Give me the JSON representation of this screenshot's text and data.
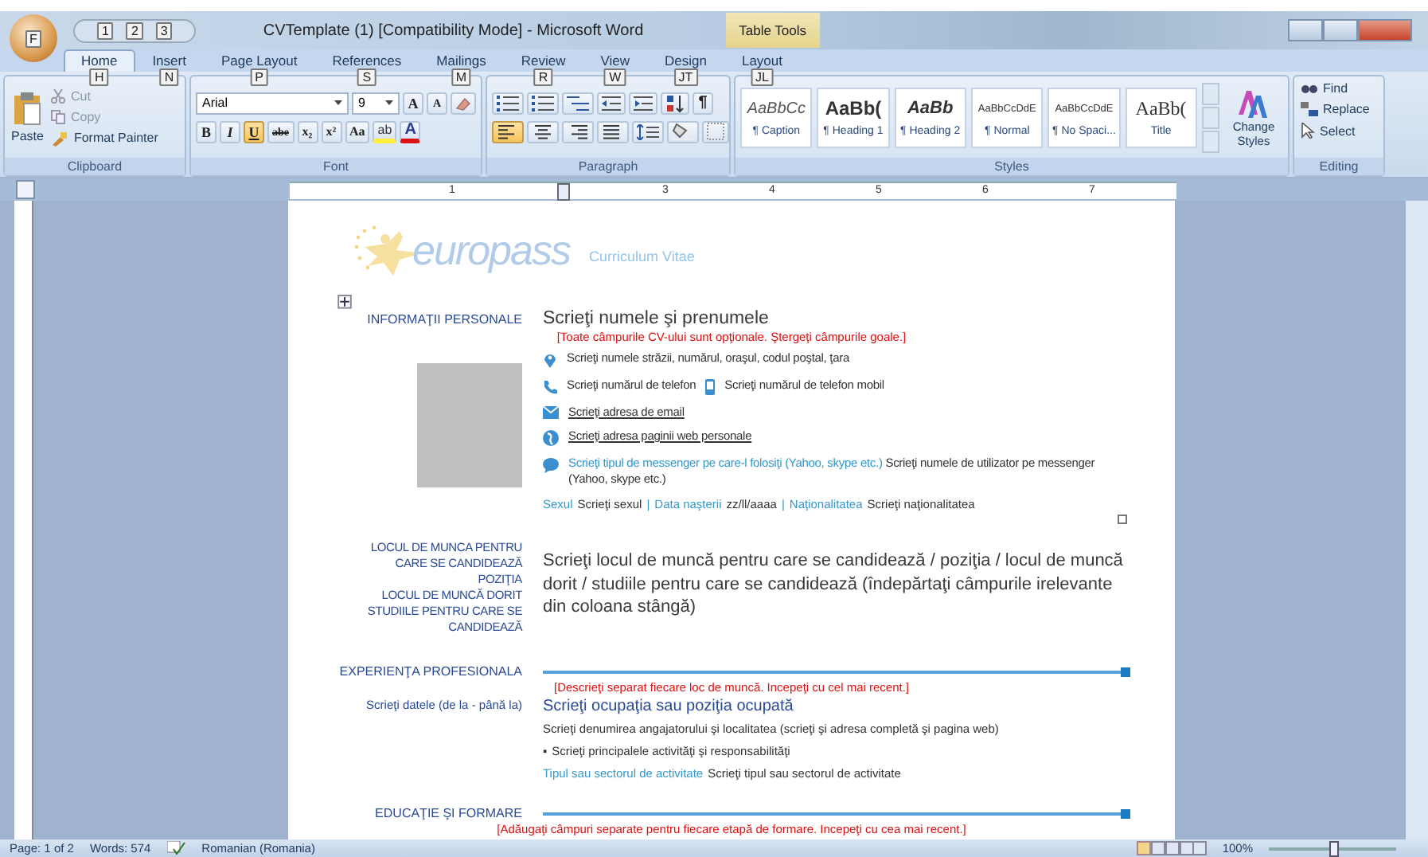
{
  "window": {
    "title": "CVTemplate (1) [Compatibility Mode] - Microsoft Word",
    "context_tab": "Table Tools",
    "office_keytip": "F",
    "quick_access_keytips": [
      "1",
      "2",
      "3"
    ]
  },
  "tabs": [
    {
      "label": "Home",
      "keytip": "H",
      "selected": true
    },
    {
      "label": "Insert",
      "keytip": "N",
      "selected": false
    },
    {
      "label": "Page Layout",
      "keytip": "P",
      "selected": false
    },
    {
      "label": "References",
      "keytip": "S",
      "selected": false
    },
    {
      "label": "Mailings",
      "keytip": "M",
      "selected": false
    },
    {
      "label": "Review",
      "keytip": "R",
      "selected": false
    },
    {
      "label": "View",
      "keytip": "W",
      "selected": false
    },
    {
      "label": "Design",
      "keytip": "JT",
      "selected": false
    },
    {
      "label": "Layout",
      "keytip": "JL",
      "selected": false
    }
  ],
  "clipboard": {
    "label": "Clipboard",
    "paste": "Paste",
    "cut": "Cut",
    "copy": "Copy",
    "format_painter": "Format Painter"
  },
  "font": {
    "label": "Font",
    "name": "Arial",
    "size": "9",
    "grow": "A",
    "shrink": "A",
    "styles": [
      {
        "label": "B",
        "kind": "bold",
        "on": false
      },
      {
        "label": "I",
        "kind": "italic",
        "on": false
      },
      {
        "label": "U",
        "kind": "underline",
        "on": true
      },
      {
        "label": "abe",
        "kind": "strike",
        "on": false
      },
      {
        "label": "x₂",
        "kind": "sub",
        "on": false
      },
      {
        "label": "x²",
        "kind": "sup",
        "on": false
      },
      {
        "label": "Aa",
        "kind": "case",
        "on": false
      }
    ],
    "highlight_label": "ab",
    "color_label": "A"
  },
  "paragraph": {
    "label": "Paragraph",
    "pilcrow": "¶",
    "alignments": [
      {
        "kind": "left",
        "selected": true
      },
      {
        "kind": "center",
        "selected": false
      },
      {
        "kind": "right",
        "selected": false
      },
      {
        "kind": "justify",
        "selected": false
      }
    ]
  },
  "styles": {
    "label": "Styles",
    "change_styles": "Change Styles",
    "items": [
      {
        "preview": "AaBbCc",
        "name": "¶ Caption",
        "kind": "caption"
      },
      {
        "preview": "AaBb(",
        "name": "¶ Heading 1",
        "kind": "heading1"
      },
      {
        "preview": "AaBb",
        "name": "¶ Heading 2",
        "kind": "heading2"
      },
      {
        "preview": "AaBbCcDdE",
        "name": "¶ Normal",
        "kind": "normal"
      },
      {
        "preview": "AaBbCcDdE",
        "name": "¶ No Spaci...",
        "kind": "normal"
      },
      {
        "preview": "AaBb(",
        "name": "Title",
        "kind": "title"
      }
    ]
  },
  "editing": {
    "label": "Editing",
    "find": "Find",
    "replace": "Replace",
    "select": "Select"
  },
  "ruler": {
    "numbers": [
      "1",
      "3",
      "4",
      "5",
      "6",
      "7"
    ]
  },
  "document": {
    "logo": "europass",
    "cv_title": "Curriculum Vitae",
    "personal": {
      "heading": "INFORMAŢII PERSONALE",
      "name": "Scrieţi numele şi prenumele",
      "note": "[Toate câmpurile CV-ului sunt opţionale. Ştergeţi câmpurile goale.]",
      "contacts": [
        {
          "kind": "address",
          "text": "Scrieţi numele străzii, numărul, oraşul, codul poştal, ţara"
        },
        {
          "kind": "phone",
          "text": "Scrieţi numărul de telefon",
          "mobile": "Scrieţi numărul de telefon mobil"
        },
        {
          "kind": "email",
          "text": "Scrieţi adresa de email"
        },
        {
          "kind": "web",
          "text": "Scrieţi adresa paginii web personale"
        },
        {
          "kind": "messenger",
          "label": "Scrieţi tipul de messenger pe care-l folosiţi (Yahoo, skype etc.)",
          "text": "Scrieţi numele de utilizator pe messenger (Yahoo, skype etc.)"
        }
      ],
      "details": [
        {
          "label": "Sexul",
          "value": "Scrieţi sexul"
        },
        {
          "label": "Data naşterii",
          "value": "zz/ll/aaaa"
        },
        {
          "label": "Naţionalitatea",
          "value": "Scrieţi naţionalitatea"
        }
      ],
      "separator": "|"
    },
    "job": {
      "labels": [
        "LOCUL DE MUNCA PENTRU CARE SE CANDIDEAZĂ",
        "POZIŢIA",
        "LOCUL DE MUNCĂ DORIT",
        "STUDIILE PENTRU CARE SE CANDIDEAZĂ"
      ],
      "text": "Scrieţi locul de muncă pentru care se candidează / poziţia / locul de muncă dorit / studiile pentru care se candidează (îndepărtaţi câmpurile irelevante din coloana stângă)"
    },
    "experience": {
      "heading": "EXPERIENŢA PROFESIONALA",
      "note": "[Descrieţi separat fiecare loc de muncă. Incepeţi cu cel mai recent.]",
      "dates": "Scrieţi datele (de la - până la)",
      "occupation": "Scrieţi ocupaţia sau poziţia ocupată",
      "employer": "Scrieţi denumirea angajatorului şi localitatea (scrieţi şi adresa completă şi pagina web)",
      "bullet": "▪",
      "activities": "Scrieţi principalele activităţi şi responsabilităţi",
      "sector_label": "Tipul sau sectorul de activitate",
      "sector": "Scrieţi tipul sau sectorul de activitate"
    },
    "education": {
      "heading": "EDUCAŢIE ŞI FORMARE",
      "note": "[Adăugaţi câmpuri separate pentru fiecare etapă de formare. Incepeţi cu cea mai recent.]"
    }
  },
  "status_bar": {
    "page": "Page: 1 of 2",
    "words": "Words: 574",
    "language": "Romanian (Romania)",
    "zoom": "100%",
    "zoom_slider": {
      "level": 0.5
    }
  }
}
